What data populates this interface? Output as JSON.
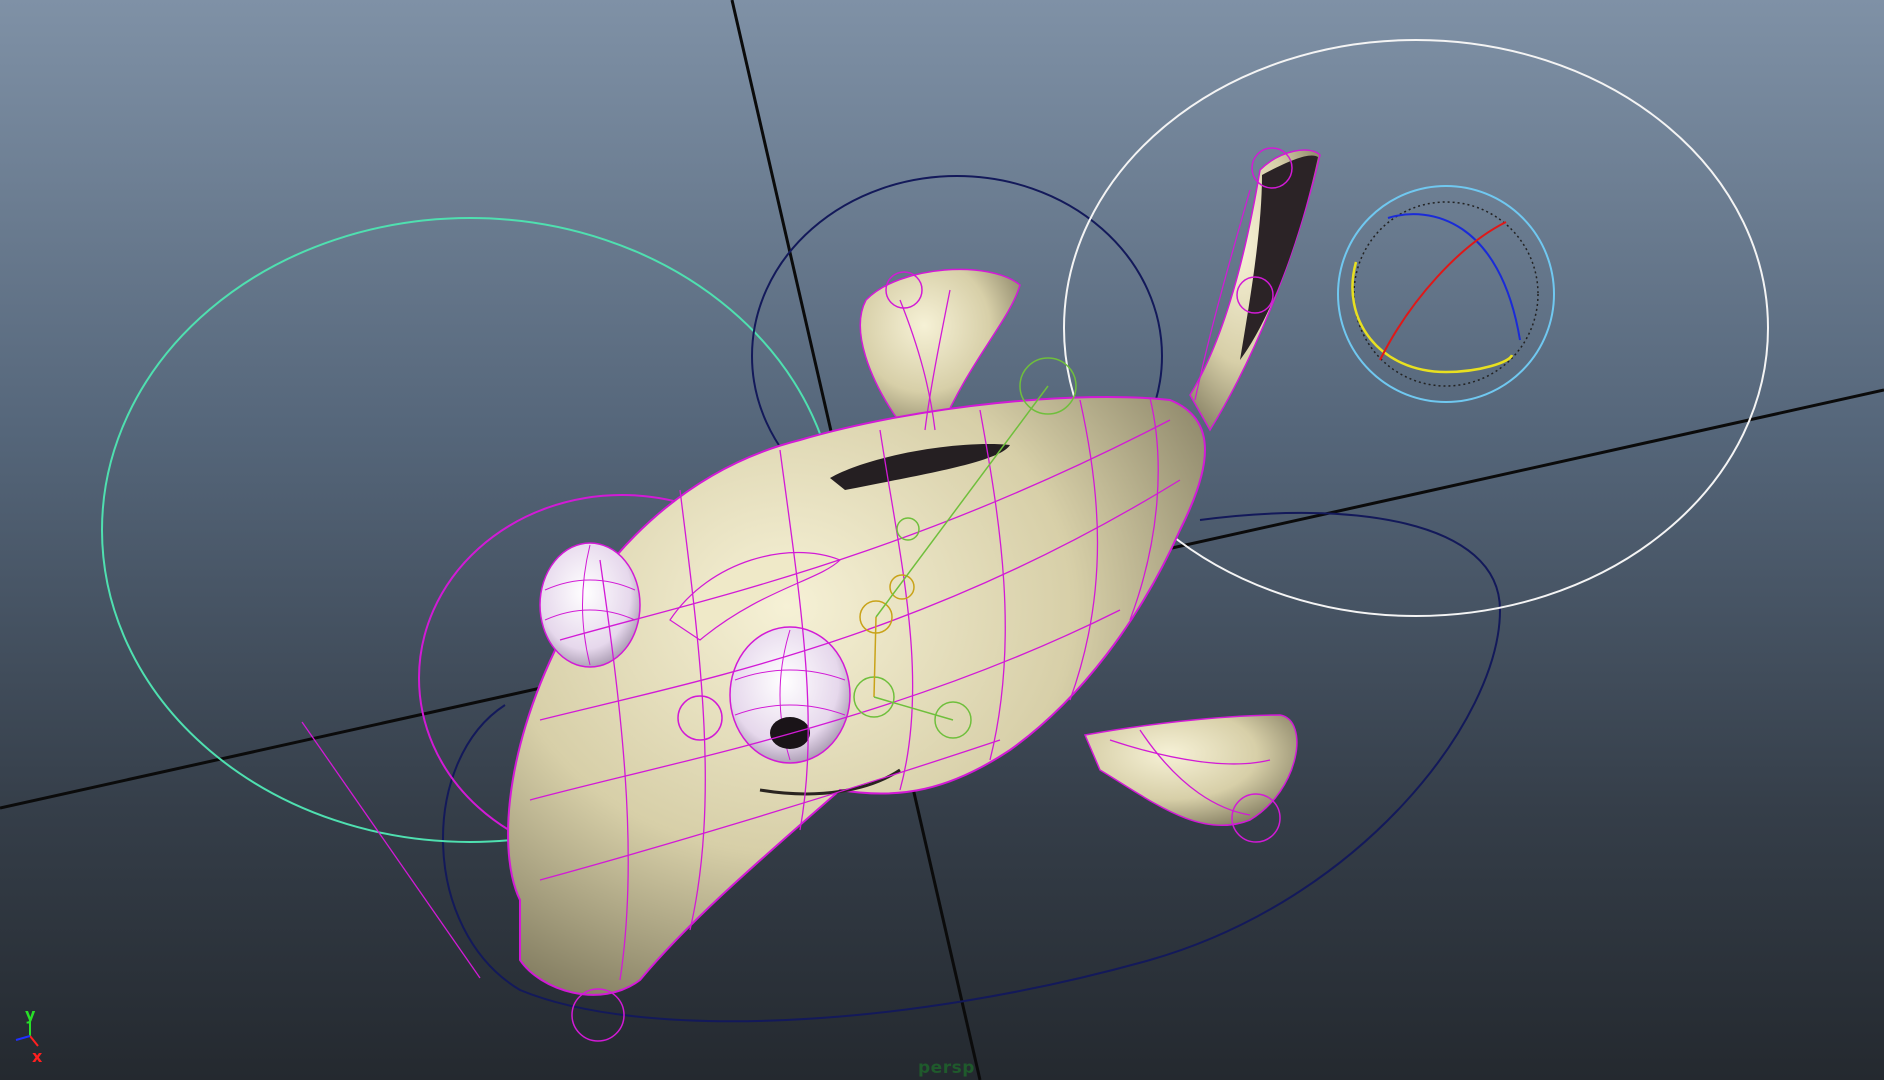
{
  "viewport": {
    "camera_label": "persp"
  },
  "axis_indicator": {
    "x_label": "x",
    "y_label": "y"
  },
  "colors": {
    "background_top": "#7f91a6",
    "background_bottom": "#24292f",
    "wireframe": "#d21ad6",
    "mesh_fill": "#ddd6b2",
    "controller_cyan": "#4fe0b0",
    "controller_navy": "#13195a",
    "controller_white": "#f4f4f4",
    "axis_x": "#ff2020",
    "axis_y": "#28e028",
    "axis_z": "#2030ff"
  },
  "scene_objects": [
    "grid-axis-lines",
    "fish-mesh",
    "fish-wireframe",
    "eye-left",
    "eye-right",
    "dorsal-fin",
    "pectoral-fin",
    "tail-fin",
    "head-controller-circle",
    "body-controller-circle",
    "tail-controller-circle",
    "master-controller-curve",
    "rotate-manipulator",
    "joint-chain"
  ]
}
